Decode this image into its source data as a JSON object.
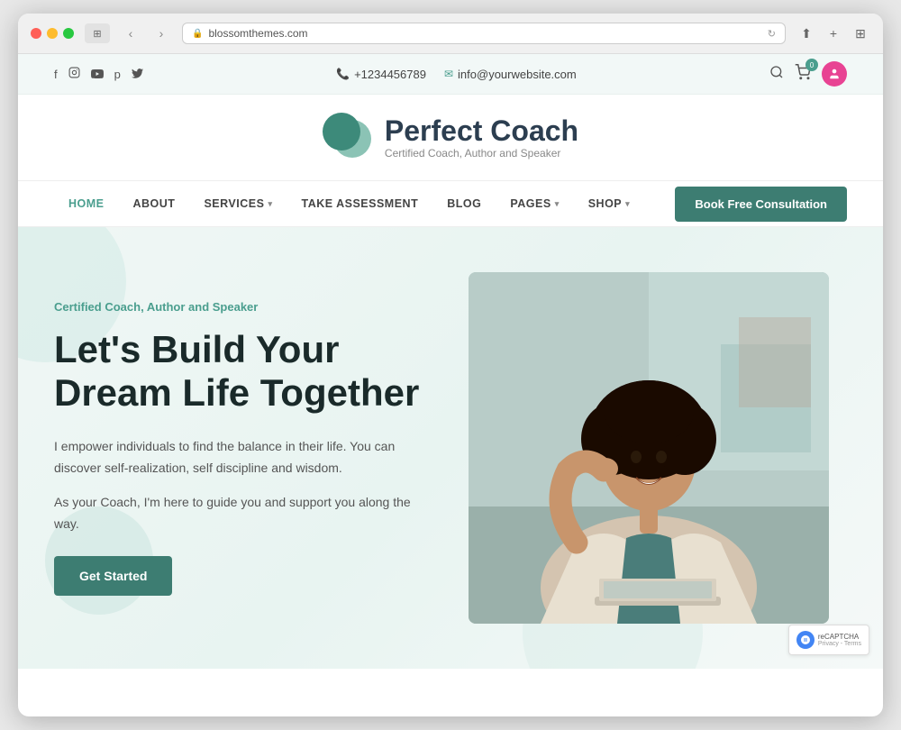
{
  "browser": {
    "url": "blossomthemes.com",
    "back_btn": "‹",
    "forward_btn": "›"
  },
  "topbar": {
    "phone": "+1234456789",
    "email": "info@yourwebsite.com",
    "social": [
      "f",
      "in",
      "▶",
      "p",
      "🐦"
    ],
    "cart_count": "0"
  },
  "header": {
    "logo_title": "Perfect Coach",
    "tagline": "Certified Coach, Author and Speaker"
  },
  "nav": {
    "items": [
      {
        "label": "HOME",
        "active": true,
        "has_dropdown": false
      },
      {
        "label": "ABOUT",
        "active": false,
        "has_dropdown": false
      },
      {
        "label": "SERVICES",
        "active": false,
        "has_dropdown": true
      },
      {
        "label": "TAKE ASSESSMENT",
        "active": false,
        "has_dropdown": false
      },
      {
        "label": "BLOG",
        "active": false,
        "has_dropdown": false
      },
      {
        "label": "PAGES",
        "active": false,
        "has_dropdown": true
      },
      {
        "label": "SHOP",
        "active": false,
        "has_dropdown": true
      }
    ],
    "cta_label": "Book Free Consultation"
  },
  "hero": {
    "subtitle": "Certified Coach, Author and Speaker",
    "title_line1": "Let's Build Your",
    "title_line2": "Dream Life Together",
    "body1": "I empower individuals to find the balance in their life. You can discover self-realization, self discipline and wisdom.",
    "body2": "As your Coach, I'm here to guide you and support you along the way.",
    "cta_label": "Get Started"
  },
  "recaptcha": {
    "label": "reCAPTCHA",
    "subtext": "Privacy - Terms"
  },
  "colors": {
    "teal": "#3d7d72",
    "teal_light": "#4a9e8e",
    "pink": "#e84393"
  }
}
